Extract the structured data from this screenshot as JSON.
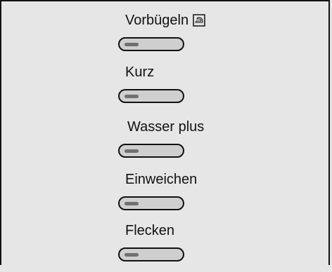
{
  "programs": [
    {
      "label": "Vorbügeln",
      "icon": "iron-icon"
    },
    {
      "label": "Kurz"
    },
    {
      "label": "Wasser plus"
    },
    {
      "label": "Einweichen"
    },
    {
      "label": "Flecken"
    }
  ]
}
